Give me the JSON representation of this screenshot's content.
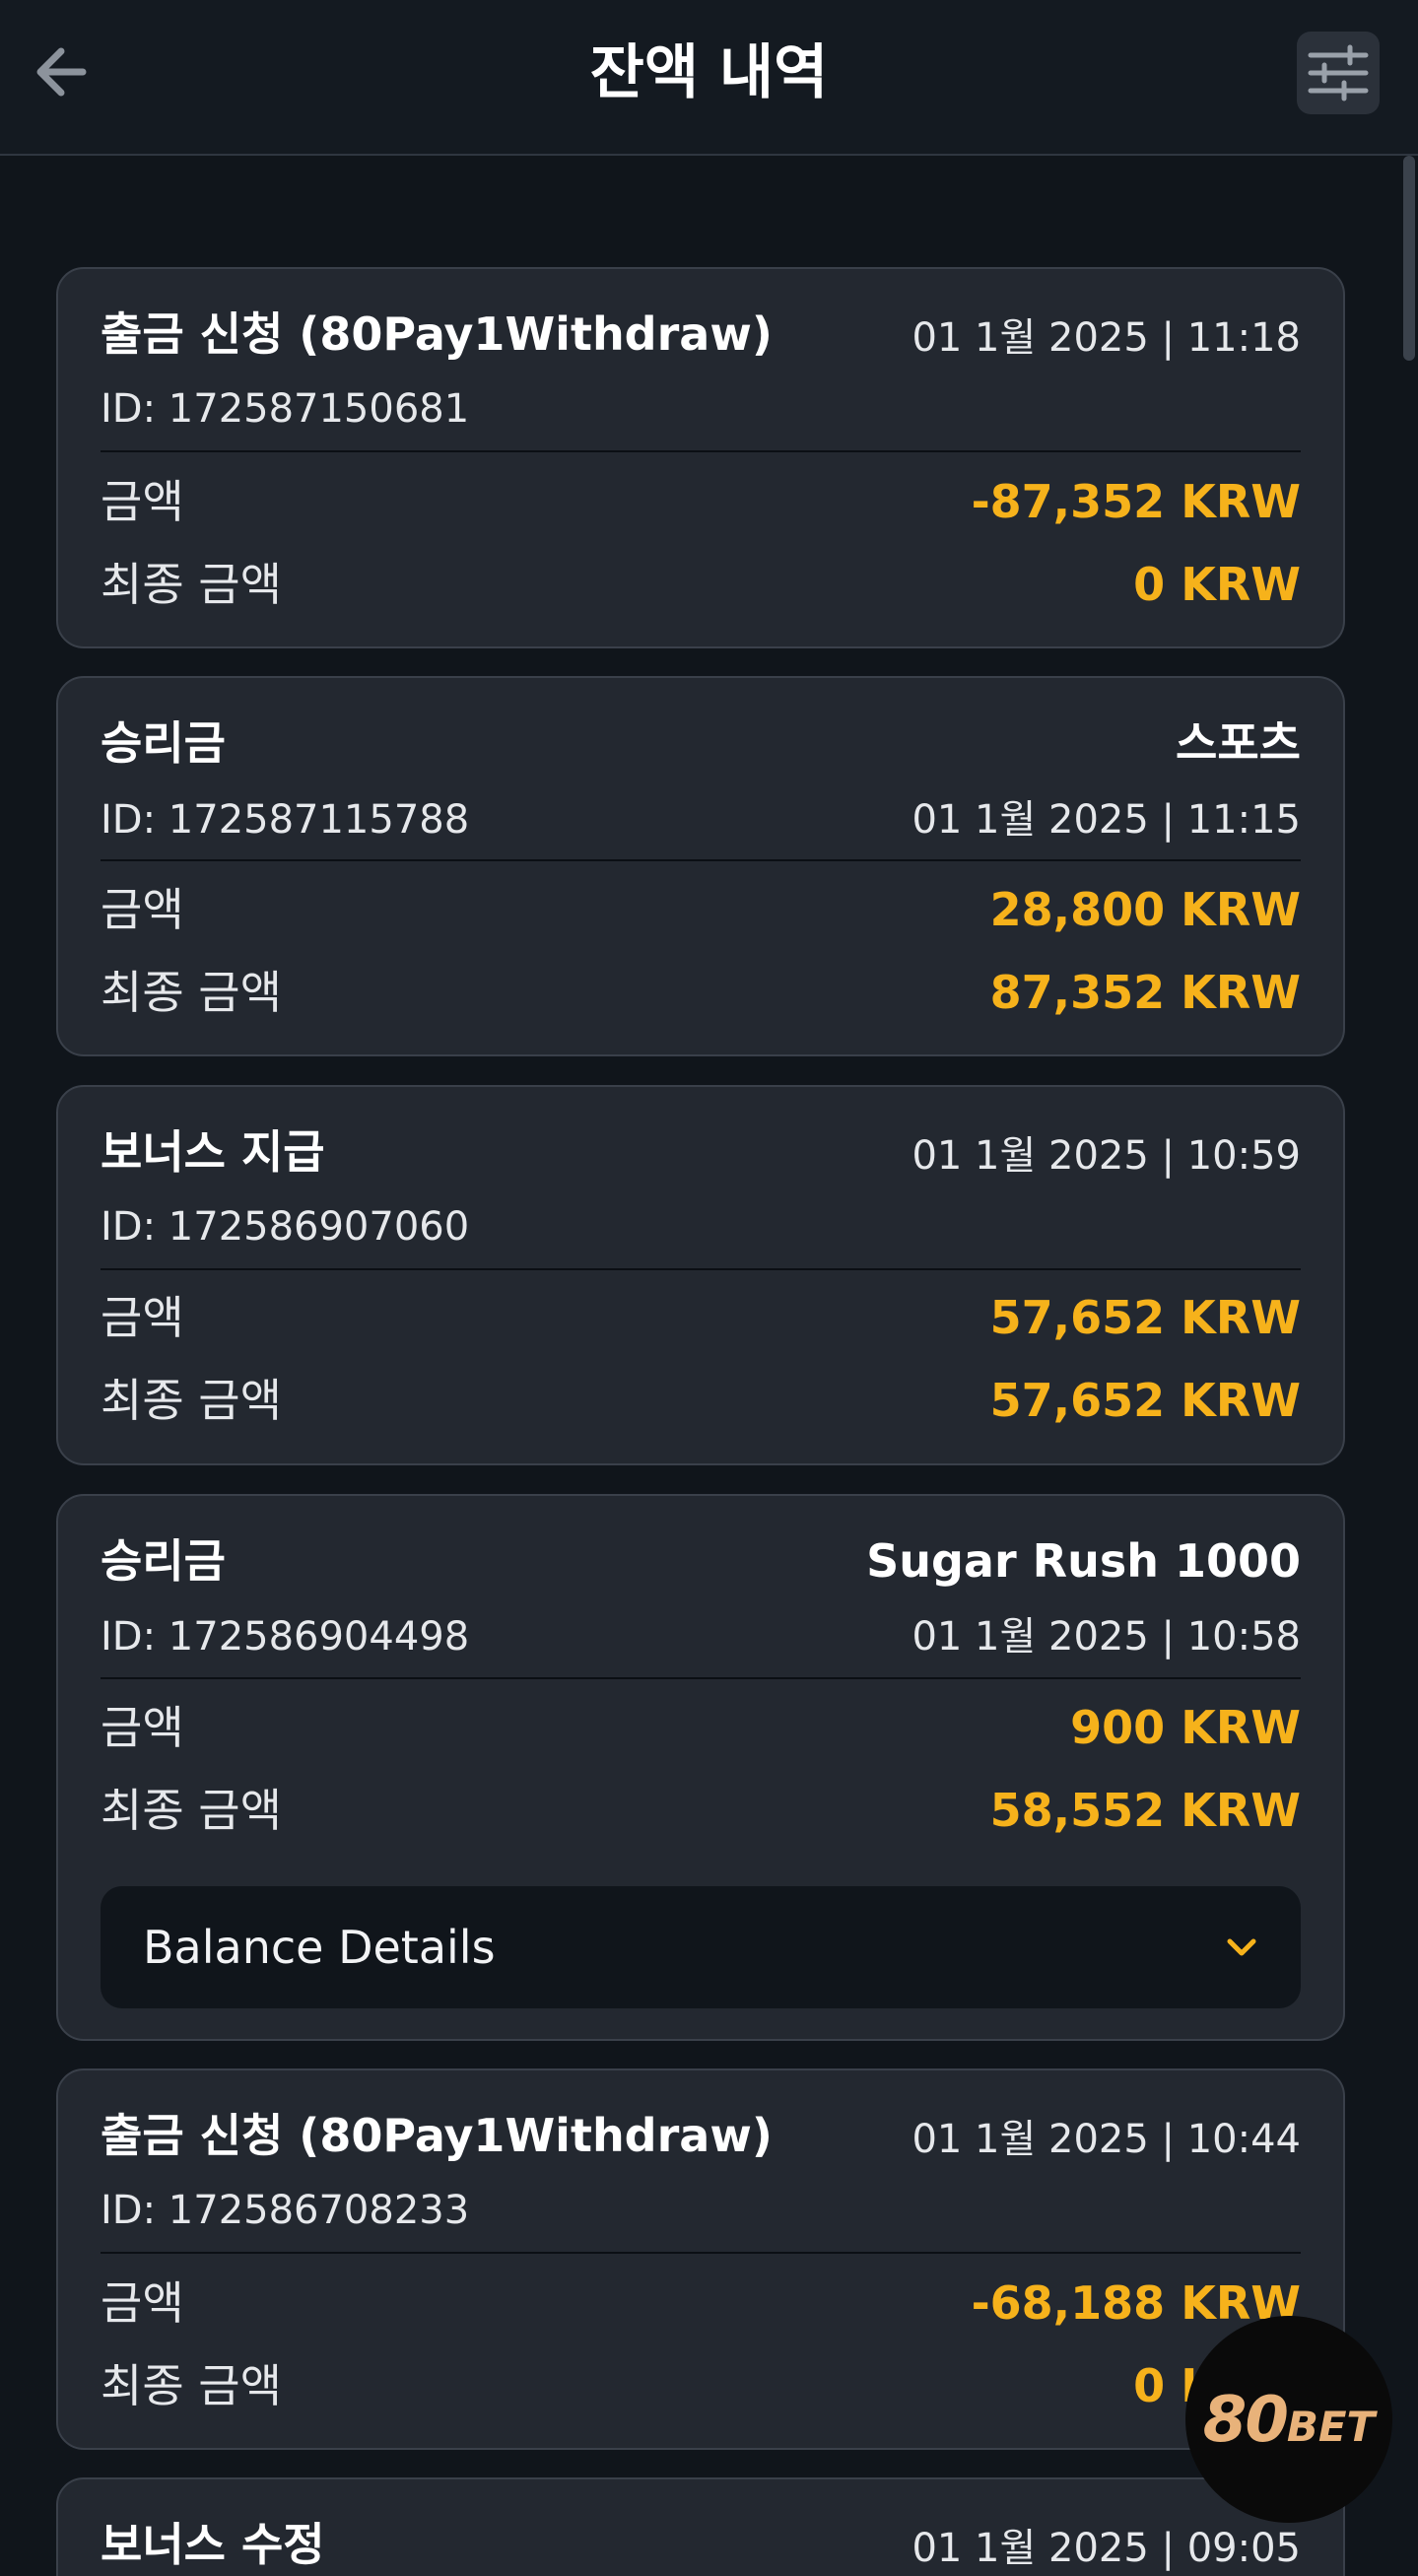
{
  "header": {
    "title": "잔액 내역",
    "back_icon": "arrow-left-icon",
    "filter_icon": "sliders-icon"
  },
  "colors": {
    "background": "#10151b",
    "card": "#232830",
    "amount": "#f6b21b",
    "text": "#ffffff"
  },
  "transactions": [
    {
      "type": "출금 신청 (80Pay1Withdraw)",
      "date": "01 1월 2025 | 11:18",
      "id": "ID: 172587150681",
      "amount_label": "금액",
      "amount": "-87,352 KRW",
      "final_label": "최종 금액",
      "final_amount": "0 KRW"
    },
    {
      "type": "승리금",
      "source": "스포츠",
      "date": "01 1월 2025 | 11:15",
      "id": "ID: 172587115788",
      "amount_label": "금액",
      "amount": "28,800 KRW",
      "final_label": "최종 금액",
      "final_amount": "87,352 KRW"
    },
    {
      "type": "보너스 지급",
      "date": "01 1월 2025 | 10:59",
      "id": "ID: 172586907060",
      "amount_label": "금액",
      "amount": "57,652 KRW",
      "final_label": "최종 금액",
      "final_amount": "57,652 KRW"
    },
    {
      "type": "승리금",
      "source": "Sugar Rush 1000",
      "date": "01 1월 2025 | 10:58",
      "id": "ID: 172586904498",
      "amount_label": "금액",
      "amount": "900 KRW",
      "final_label": "최종 금액",
      "final_amount": "58,552 KRW",
      "details_label": "Balance Details",
      "details_icon": "chevron-down-icon"
    },
    {
      "type": "출금 신청 (80Pay1Withdraw)",
      "date": "01 1월 2025 | 10:44",
      "id": "ID: 172586708233",
      "amount_label": "금액",
      "amount": "-68,188 KRW",
      "final_label": "최종 금액",
      "final_amount": "0 KRW"
    },
    {
      "type": "보너스 수정",
      "date": "01 1월 2025 | 09:05"
    }
  ],
  "logo": {
    "main": "80",
    "suffix": "BET"
  }
}
